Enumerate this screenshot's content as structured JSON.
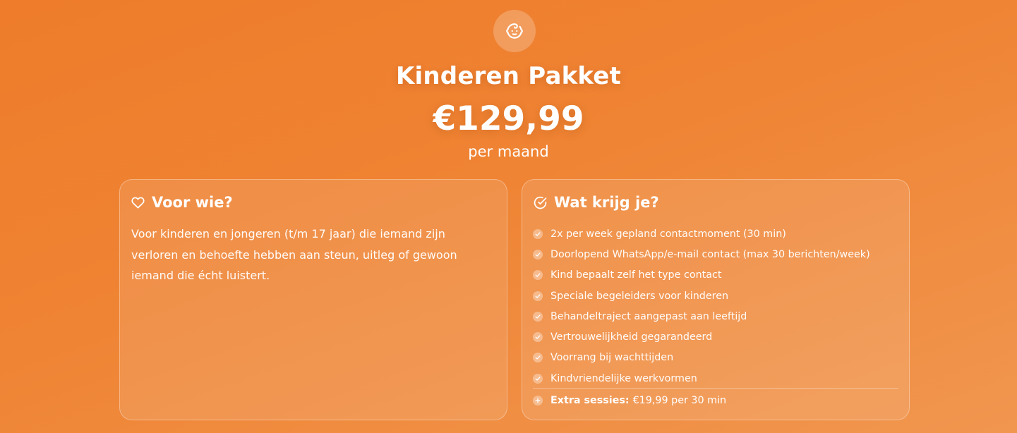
{
  "package": {
    "icon": "baby-face-icon",
    "title": "Kinderen Pakket",
    "price": "€129,99",
    "period": "per maand"
  },
  "for_who": {
    "icon": "heart-icon",
    "heading": "Voor wie?",
    "description": "Voor kinderen en jongeren (t/m 17 jaar) die iemand zijn verloren en behoefte hebben aan steun, uitleg of gewoon iemand die écht luistert."
  },
  "what_you_get": {
    "icon": "check-circle-icon",
    "heading": "Wat krijg je?",
    "items": [
      "2x per week gepland contactmoment (30 min)",
      "Doorlopend WhatsApp/e-mail contact (max 30 berichten/week)",
      "Kind bepaalt zelf het type contact",
      "Speciale begeleiders voor kinderen",
      "Behandeltraject aangepast aan leeftijd",
      "Vertrouwelijkheid gegarandeerd",
      "Voorrang bij wachttijden",
      "Kindvriendelijke werkvormen"
    ],
    "extra": {
      "icon": "plus-icon",
      "label": "Extra sessies:",
      "value": "€19,99 per 30 min"
    }
  },
  "colors": {
    "background_start": "#ee7c2a",
    "background_end": "#f1964f",
    "text": "#ffffff"
  }
}
